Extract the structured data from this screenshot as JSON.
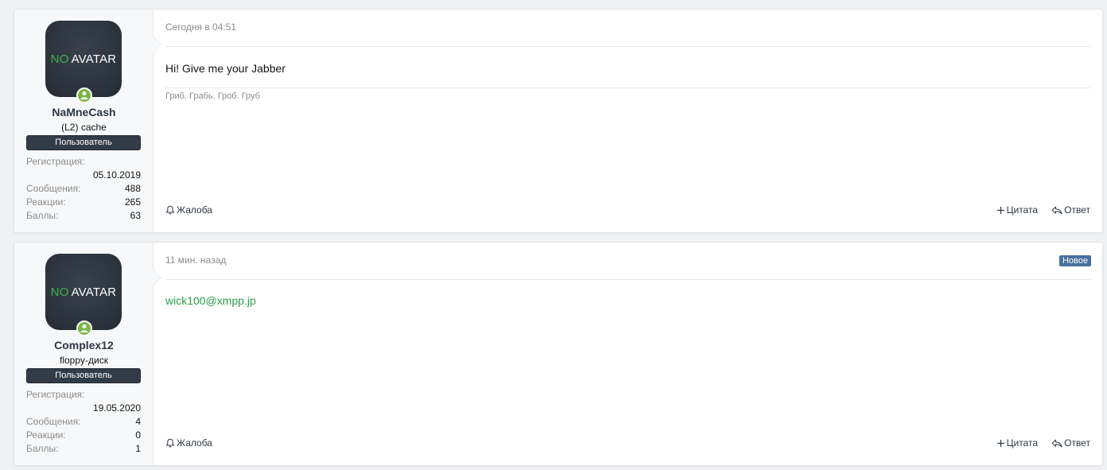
{
  "posts": [
    {
      "user": {
        "avatar_no": "NO",
        "avatar_text": "AVATAR",
        "name": "NaMneCash",
        "title": "(L2) cache",
        "banner": "Пользователь",
        "reg_label": "Регистрация:",
        "reg_value": "05.10.2019",
        "msgs_label": "Сообщения:",
        "msgs_value": "488",
        "reactions_label": "Реакции:",
        "reactions_value": "265",
        "points_label": "Баллы:",
        "points_value": "63"
      },
      "date": "Сегодня в 04:51",
      "message": "Hi! Give me your Jabber",
      "signature": "Гриб. Грабь. Гроб. Груб",
      "report": "Жалоба",
      "quote": "Цитата",
      "reply": "Ответ"
    },
    {
      "user": {
        "avatar_no": "NO",
        "avatar_text": "AVATAR",
        "name": "Complex12",
        "title": "floppy-диск",
        "banner": "Пользователь",
        "reg_label": "Регистрация:",
        "reg_value": "19.05.2020",
        "msgs_label": "Сообщения:",
        "msgs_value": "4",
        "reactions_label": "Реакции:",
        "reactions_value": "0",
        "points_label": "Баллы:",
        "points_value": "1"
      },
      "date": "11 мин. назад",
      "badge": "Новое",
      "message": "wick100@xmpp.jp",
      "report": "Жалоба",
      "quote": "Цитата",
      "reply": "Ответ"
    }
  ],
  "colors": {
    "accent_green": "#2a9d4b",
    "banner_bg": "#323b48",
    "new_badge": "#47709e",
    "online_dot": "#7ab648"
  },
  "icons": {
    "report": "bell-icon",
    "quote": "plus-icon",
    "reply": "reply-arrow-icon",
    "online": "user-online-icon"
  }
}
